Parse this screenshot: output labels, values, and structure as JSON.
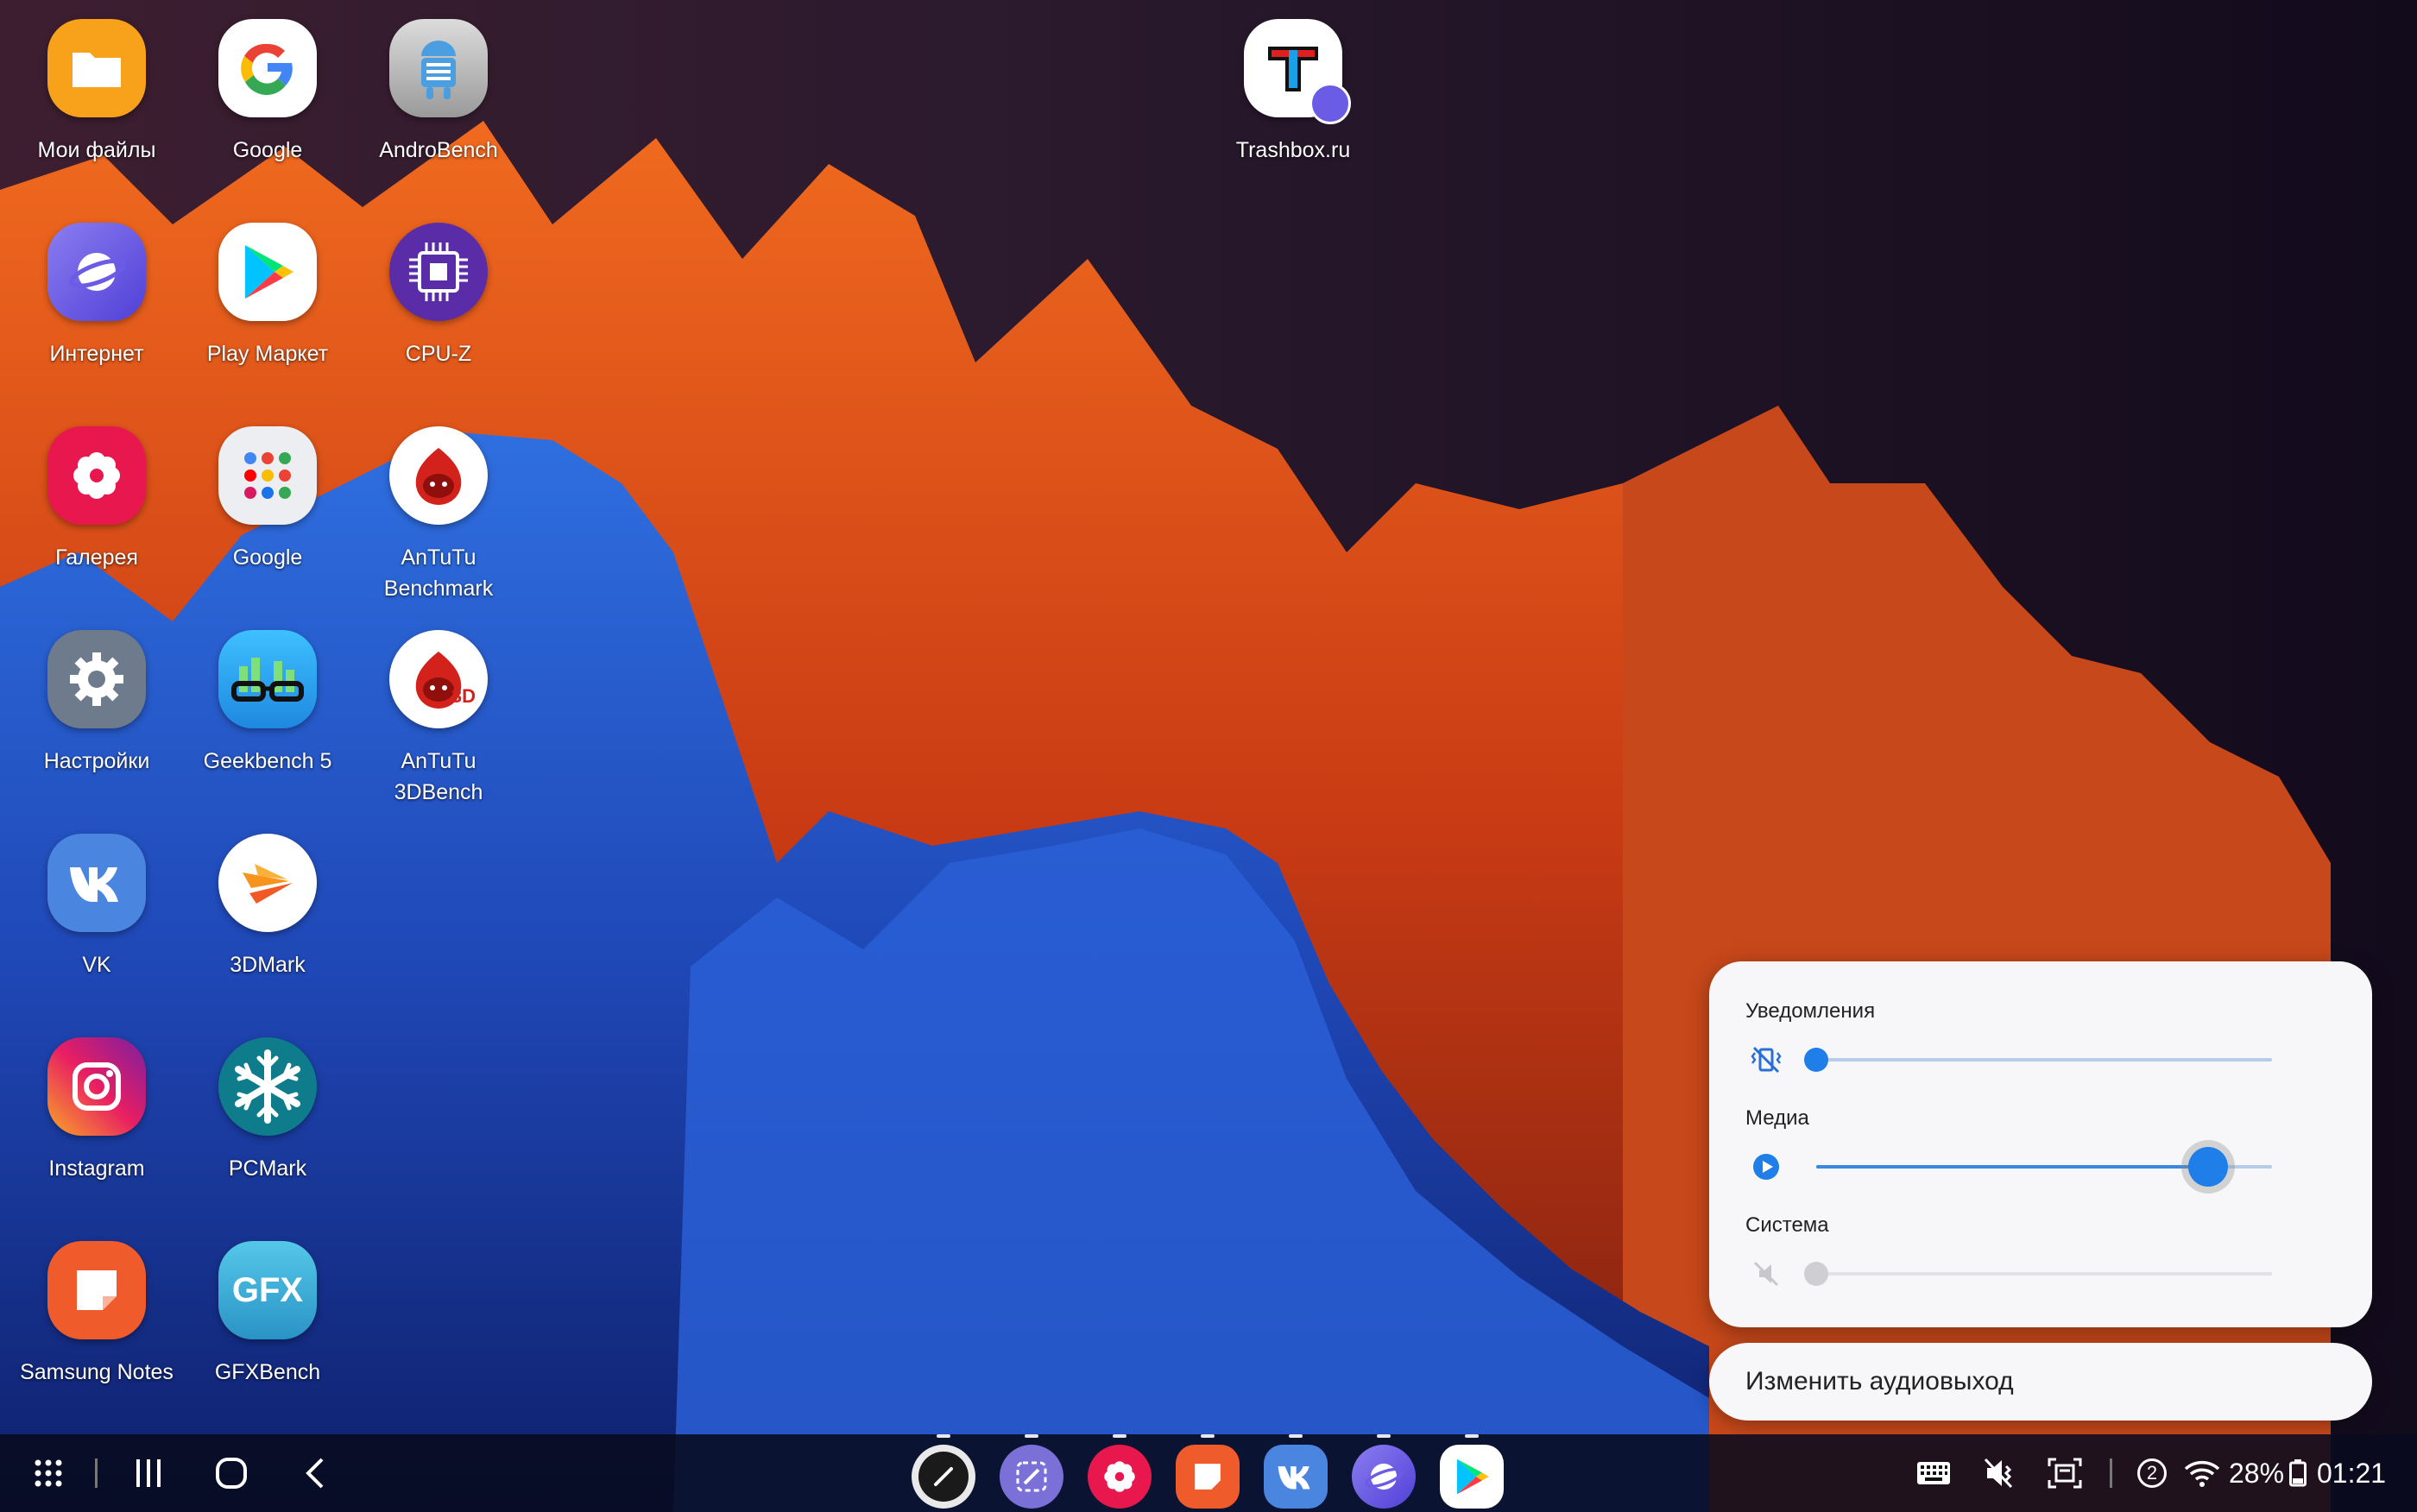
{
  "desktop": {
    "apps": [
      {
        "label": "Мои файлы",
        "icon": "folder-icon"
      },
      {
        "label": "Google",
        "icon": "google-g-icon"
      },
      {
        "label": "AndroBench",
        "icon": "android-robot-icon"
      },
      {
        "label": "Trashbox.ru",
        "icon": "trashbox-t-icon"
      },
      {
        "label": "Интернет",
        "icon": "samsung-internet-icon"
      },
      {
        "label": "Play Маркет",
        "icon": "play-store-icon"
      },
      {
        "label": "CPU-Z",
        "icon": "cpu-chip-icon"
      },
      {
        "label": "Галерея",
        "icon": "gallery-flower-icon"
      },
      {
        "label": "Google",
        "icon": "google-folder-icon"
      },
      {
        "label": "AnTuTu\nBenchmark",
        "icon": "antutu-icon"
      },
      {
        "label": "Настройки",
        "icon": "gear-icon"
      },
      {
        "label": "Geekbench 5",
        "icon": "geekbench-icon"
      },
      {
        "label": "AnTuTu\n3DBench",
        "icon": "antutu-3d-icon"
      },
      {
        "label": "VK",
        "icon": "vk-icon"
      },
      {
        "label": "3DMark",
        "icon": "3dmark-icon"
      },
      {
        "label": "Instagram",
        "icon": "instagram-icon"
      },
      {
        "label": "PCMark",
        "icon": "pcmark-snowflake-icon"
      },
      {
        "label": "Samsung Notes",
        "icon": "samsung-notes-icon"
      },
      {
        "label": "GFXBench",
        "icon": "gfxbench-icon"
      }
    ],
    "gfx_text": "GFX",
    "antutu_3d_text": "3D"
  },
  "volume_panel": {
    "notifications": {
      "label": "Уведомления",
      "level": 0,
      "icon": "vibrate-icon"
    },
    "media": {
      "label": "Медиа",
      "level": 0.86,
      "icon": "play-circle-icon"
    },
    "system": {
      "label": "Система",
      "level": 0,
      "icon": "mute-icon"
    },
    "output_button": "Изменить аудиовыход"
  },
  "taskbar": {
    "left_buttons": [
      "apps-grid-icon",
      "recents-icon",
      "home-icon",
      "back-icon"
    ],
    "dock": [
      "pen-icon",
      "pen-up-icon",
      "gallery-icon",
      "notes-icon",
      "vk-icon",
      "internet-icon",
      "play-store-icon"
    ],
    "status": {
      "notification_count": "2",
      "battery_percent": "28%",
      "time": "01:21"
    }
  },
  "colors": {
    "accent": "#1f7ee8",
    "panel_bg": "#f7f7f9",
    "taskbar_bg": "#080a1e"
  }
}
